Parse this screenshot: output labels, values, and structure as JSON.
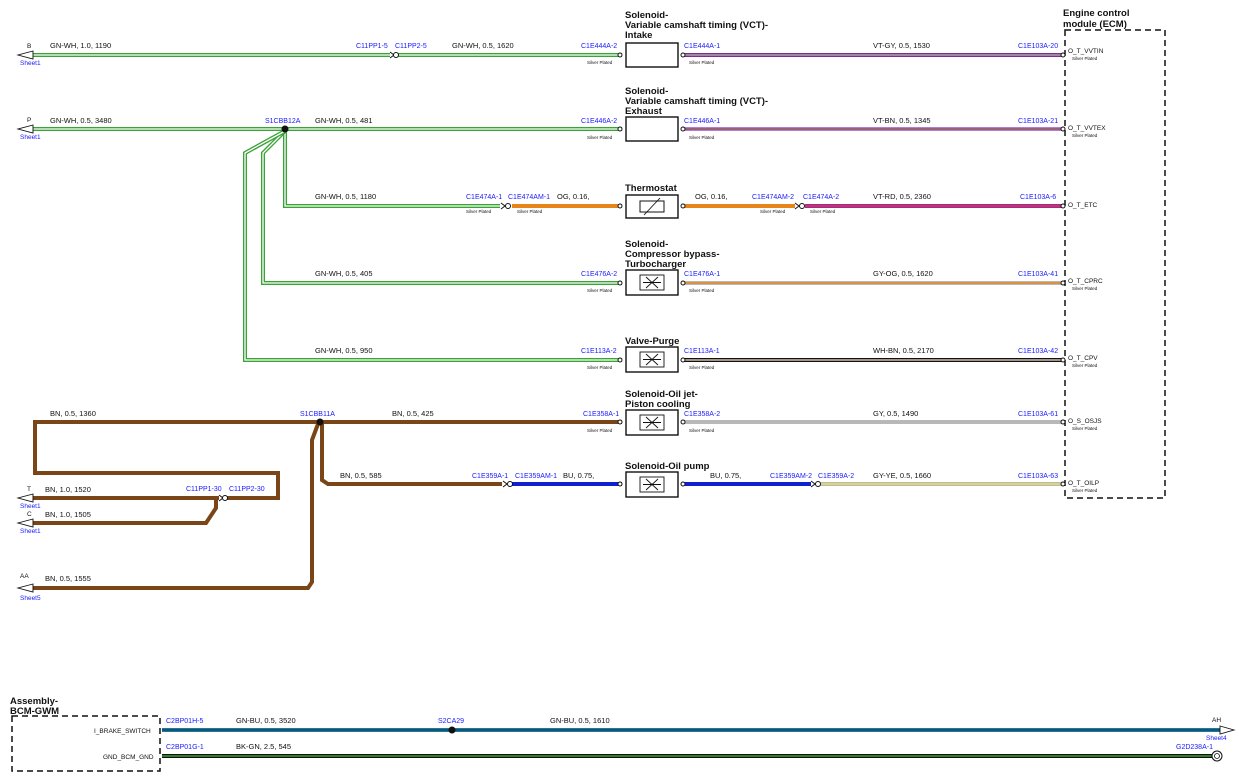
{
  "colors": {
    "GN": "#3aa335",
    "BN": "#7a4517",
    "OG": "#e8851a",
    "BU": "#1020d0",
    "VT": "#7b2f8a",
    "VT_light": "#b07fd8",
    "RD": "#e03060",
    "GY": "#b8b8b8",
    "YE": "#e8e060",
    "BK": "#111111",
    "WH": "#ffffff"
  },
  "modules": {
    "ecm": {
      "title_line1": "Engine control",
      "title_line2": "module (ECM)"
    },
    "bcm": {
      "title_line1": "Assembly-",
      "title_line2": "BCM-GWM"
    }
  },
  "components": [
    {
      "id": "vct_intake",
      "title": [
        "Solenoid-",
        "Variable camshaft timing (VCT)-",
        "Intake"
      ],
      "type": "solenoid_plain"
    },
    {
      "id": "vct_exhaust",
      "title": [
        "Solenoid-",
        "Variable camshaft timing (VCT)-",
        "Exhaust"
      ],
      "type": "solenoid_plain"
    },
    {
      "id": "thermostat",
      "title": [
        "Thermostat"
      ],
      "type": "thermostat"
    },
    {
      "id": "cbv",
      "title": [
        "Solenoid-",
        "Compressor bypass-",
        "Turbocharger"
      ],
      "type": "solenoid_valve"
    },
    {
      "id": "purge",
      "title": [
        "Valve-Purge"
      ],
      "type": "solenoid_valve"
    },
    {
      "id": "oiljet",
      "title": [
        "Solenoid-Oil jet-",
        "Piston cooling"
      ],
      "type": "solenoid_valve"
    },
    {
      "id": "oilpump",
      "title": [
        "Solenoid-Oil pump"
      ],
      "type": "solenoid_valve"
    }
  ],
  "offpage": [
    {
      "id": "B",
      "letter": "B",
      "sheet": "Sheet1"
    },
    {
      "id": "P",
      "letter": "P",
      "sheet": "Sheet1"
    },
    {
      "id": "T",
      "letter": "T",
      "sheet": "Sheet1"
    },
    {
      "id": "C",
      "letter": "C",
      "sheet": "Sheet1"
    },
    {
      "id": "AA",
      "letter": "AA",
      "sheet": "Sheet5"
    },
    {
      "id": "AH",
      "letter": "AH",
      "sheet": "Sheet4"
    }
  ],
  "splices": {
    "s1cbb12a": "S1CBB12A",
    "s1cbb11a": "S1CBB11A",
    "s2ca29": "S2CA29"
  },
  "silver_plated": "Silver Plated",
  "rows": {
    "b": {
      "wire_left": "GN-WH,  1.0,  1190",
      "conn_pp_a": "C11PP1-5",
      "conn_pp_b": "C11PP2-5",
      "wire_mid": "GN-WH,  0.5,  1620",
      "conn_comp_a": "C1E444A-2",
      "conn_comp_b": "C1E444A-1",
      "wire_right": "VT-GY,  0.5,  1530",
      "conn_ecm": "C1E103A-20",
      "pin": "O_T_VVTIN"
    },
    "p": {
      "wire_left": "GN-WH,  0.5,  3480",
      "wire_mid": "GN-WH,  0.5,  481",
      "conn_comp_a": "C1E446A-2",
      "conn_comp_b": "C1E446A-1",
      "wire_right": "VT-BN,  0.5,  1345",
      "conn_ecm": "C1E103A-21",
      "pin": "O_T_VVTEX"
    },
    "therm": {
      "wire_left": "GN-WH,  0.5,  1180",
      "conn_a1": "C1E474A-1",
      "conn_a2": "C1E474AM-1",
      "wire_og_left": "OG,  0.16,",
      "wire_og_right": "OG,  0.16,",
      "conn_b1": "C1E474AM-2",
      "conn_b2": "C1E474A-2",
      "wire_right": "VT-RD,  0.5,  2360",
      "conn_ecm": "C1E103A-6",
      "pin": "O_T_ETC"
    },
    "cbv": {
      "wire_left": "GN-WH,  0.5,  405",
      "conn_comp_a": "C1E476A-2",
      "conn_comp_b": "C1E476A-1",
      "wire_right": "GY-OG,  0.5,  1620",
      "conn_ecm": "C1E103A-41",
      "pin": "O_T_CPRC"
    },
    "purge": {
      "wire_left": "GN-WH,  0.5,  950",
      "conn_comp_a": "C1E113A-2",
      "conn_comp_b": "C1E113A-1",
      "wire_right": "WH-BN,  0.5,  2170",
      "conn_ecm": "C1E103A-42",
      "pin": "O_T_CPV"
    },
    "oiljet": {
      "wire_loop": "BN,  0.5,  1360",
      "wire_mid": "BN,  0.5,  425",
      "conn_comp_a": "C1E358A-1",
      "conn_comp_b": "C1E358A-2",
      "wire_right": "GY,  0.5,  1490",
      "conn_ecm": "C1E103A-61",
      "pin": "O_S_OSJS"
    },
    "oilpump": {
      "wire_left": "BN,  0.5,  585",
      "conn_a1": "C1E359A-1",
      "conn_a2": "C1E359AM-1",
      "wire_bu_left": "BU,  0.75,",
      "wire_bu_right": "BU,  0.75,",
      "conn_b1": "C1E359AM-2",
      "conn_b2": "C1E359A-2",
      "wire_right": "GY-YE,  0.5,  1660",
      "conn_ecm": "C1E103A-63",
      "pin": "O_T_OILP"
    },
    "t": {
      "wire": "BN,  1.0,  1520",
      "conn_pp_a": "C11PP1-30",
      "conn_pp_b": "C11PP2-30"
    },
    "c": {
      "wire": "BN,  1.0,  1505"
    },
    "aa": {
      "wire": "BN,  0.5,  1555"
    },
    "brake": {
      "pin": "I_BRAKE_SWITCH",
      "conn": "C2BP01H-5",
      "wire_left": "GN-BU,  0.5,  3520",
      "wire_right": "GN-BU,  0.5,  1610"
    },
    "gnd": {
      "pin": "GND_BCM_GND",
      "conn": "C2BP01G-1",
      "wire": "BK-GN,  2.5,  545",
      "conn_ground": "G2D238A-1"
    }
  }
}
